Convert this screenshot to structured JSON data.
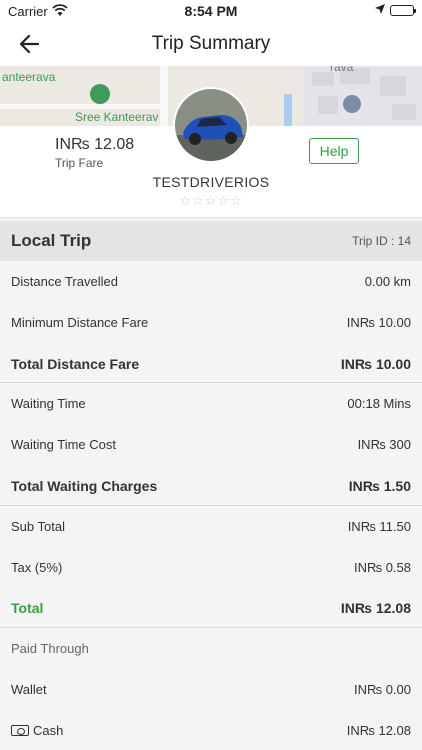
{
  "status_bar": {
    "carrier": "Carrier",
    "time": "8:54 PM"
  },
  "header": {
    "title": "Trip Summary"
  },
  "map": {
    "labels": [
      "anteerava",
      "Sree Kanteerav",
      "rava"
    ]
  },
  "trip_fare": {
    "amount": "IN₨ 12.08",
    "label": "Trip Fare"
  },
  "help_label": "Help",
  "driver": {
    "name": "TESTDRIVERIOS",
    "rating_stars": "☆☆☆☆☆"
  },
  "trip": {
    "type": "Local Trip",
    "id_text": "Trip ID : 14"
  },
  "rows": [
    {
      "label": "Distance Travelled",
      "value": "0.00 km"
    },
    {
      "label": "Minimum Distance Fare",
      "value": "IN₨ 10.00"
    },
    {
      "label": "Total Distance Fare",
      "value": "IN₨ 10.00"
    },
    {
      "label": "Waiting Time",
      "value": "00:18 Mins"
    },
    {
      "label": "Waiting Time Cost",
      "value": "IN₨ 300"
    },
    {
      "label": "Total Waiting Charges",
      "value": "IN₨ 1.50"
    },
    {
      "label": "Sub Total",
      "value": "IN₨ 11.50"
    },
    {
      "label": "Tax (5%)",
      "value": "IN₨ 0.58"
    },
    {
      "label": "Total",
      "value": "IN₨ 12.08"
    },
    {
      "label": "Paid Through",
      "value": ""
    },
    {
      "label": "Wallet",
      "value": "IN₨ 0.00"
    },
    {
      "label": "Cash",
      "value": "IN₨ 12.08"
    }
  ],
  "colors": {
    "accent": "#35a04a",
    "section_header": "#e4e4e4"
  }
}
